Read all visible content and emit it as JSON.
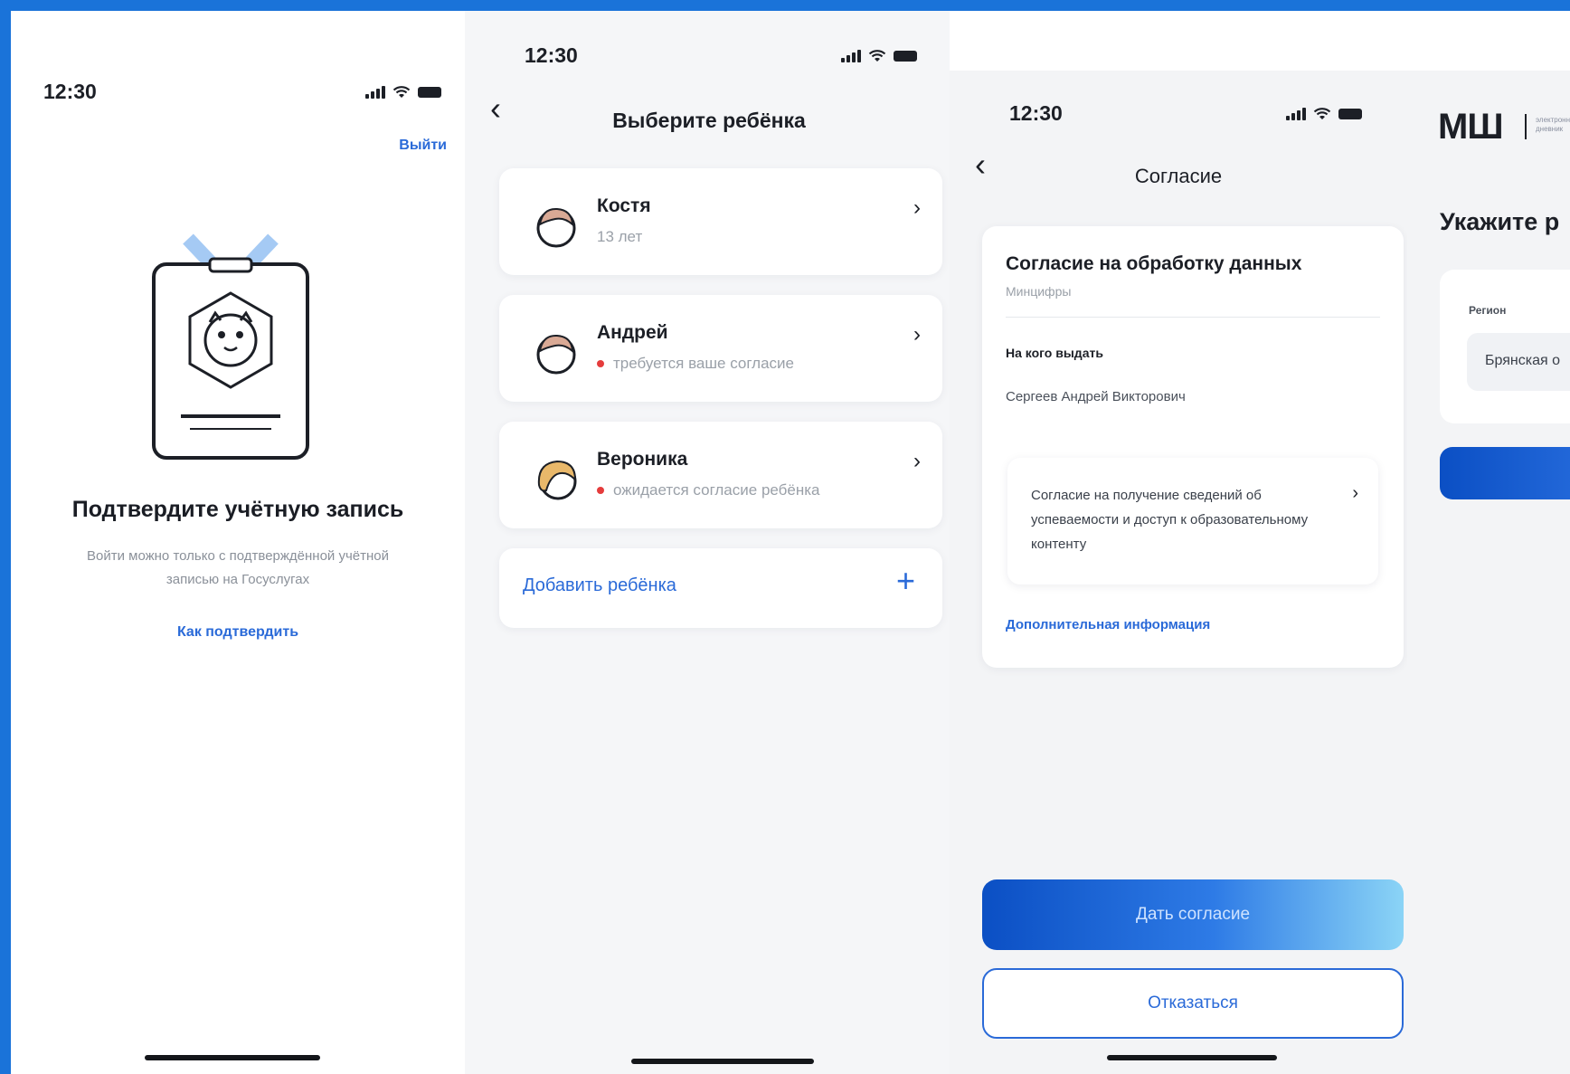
{
  "screen1": {
    "status_time": "12:30",
    "exit_label": "Выйти",
    "title": "Подтвердите учётную запись",
    "subtitle": "Войти можно только с подтверждённой учётной записью на Госуслугах",
    "link_label": "Как подтвердить"
  },
  "screen2": {
    "status_time": "12:30",
    "title": "Выберите ребёнка",
    "children": [
      {
        "name": "Костя",
        "sub": "13 лет",
        "alert": false
      },
      {
        "name": "Андрей",
        "sub": "требуется ваше согласие",
        "alert": true
      },
      {
        "name": "Вероника",
        "sub": "ожидается согласие ребёнка",
        "alert": true
      }
    ],
    "add_label": "Добавить ребёнка",
    "add_icon": "+"
  },
  "screen3": {
    "status_time": "12:30",
    "title": "Согласие",
    "card_title": "Согласие на обработку данных",
    "card_org": "Минцифры",
    "recipient_label": "На кого выдать",
    "recipient_name": "Сергеев Андрей Викторович",
    "consent_item": "Согласие на получение сведений об успеваемости и доступ к образовательному контенту",
    "more_link": "Дополнительная информация",
    "primary_button": "Дать согласие",
    "secondary_button": "Отказаться"
  },
  "screen4": {
    "logo": "МШ",
    "logo_sub": "электронный дневник",
    "title": "Укажите р",
    "region_label": "Регион",
    "region_value": "Брянская о"
  },
  "colors": {
    "background": "#1a73d9",
    "accent": "#2a6ad8",
    "alert": "#e53c3c"
  }
}
